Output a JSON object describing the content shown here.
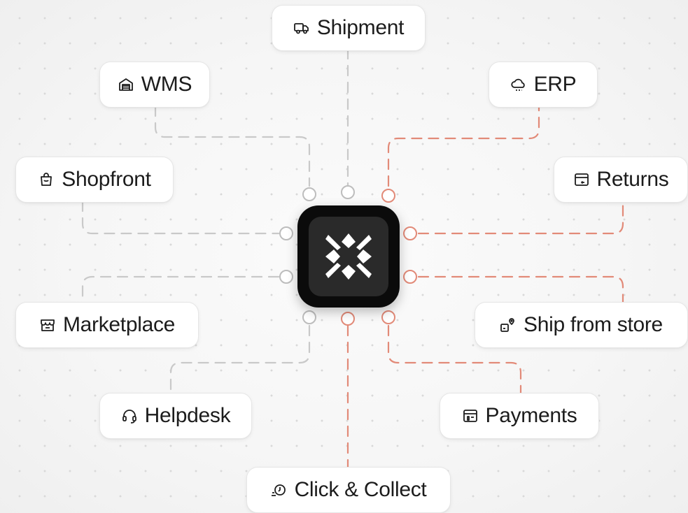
{
  "diagram": {
    "colors": {
      "accent": "#e28a78",
      "neutral_line": "#c9c9c9",
      "hub": "#0b0b0b",
      "hub_inner": "#2a2a2a"
    },
    "hub": {
      "icon": "x-logo-icon"
    },
    "nodes": [
      {
        "id": "shipment",
        "label": "Shipment",
        "icon": "truck-icon"
      },
      {
        "id": "wms",
        "label": "WMS",
        "icon": "warehouse-icon"
      },
      {
        "id": "erp",
        "label": "ERP",
        "icon": "cloud-icon"
      },
      {
        "id": "shopfront",
        "label": "Shopfront",
        "icon": "shopping-bag-icon"
      },
      {
        "id": "returns",
        "label": "Returns",
        "icon": "return-box-icon"
      },
      {
        "id": "marketplace",
        "label": "Marketplace",
        "icon": "storefront-icon"
      },
      {
        "id": "ship_from_store",
        "label": "Ship from store",
        "icon": "store-location-icon"
      },
      {
        "id": "helpdesk",
        "label": "Helpdesk",
        "icon": "headset-icon"
      },
      {
        "id": "payments",
        "label": "Payments",
        "icon": "card-terminal-icon"
      },
      {
        "id": "click_collect",
        "label": "Click & Collect",
        "icon": "fast-pickup-icon"
      }
    ]
  }
}
